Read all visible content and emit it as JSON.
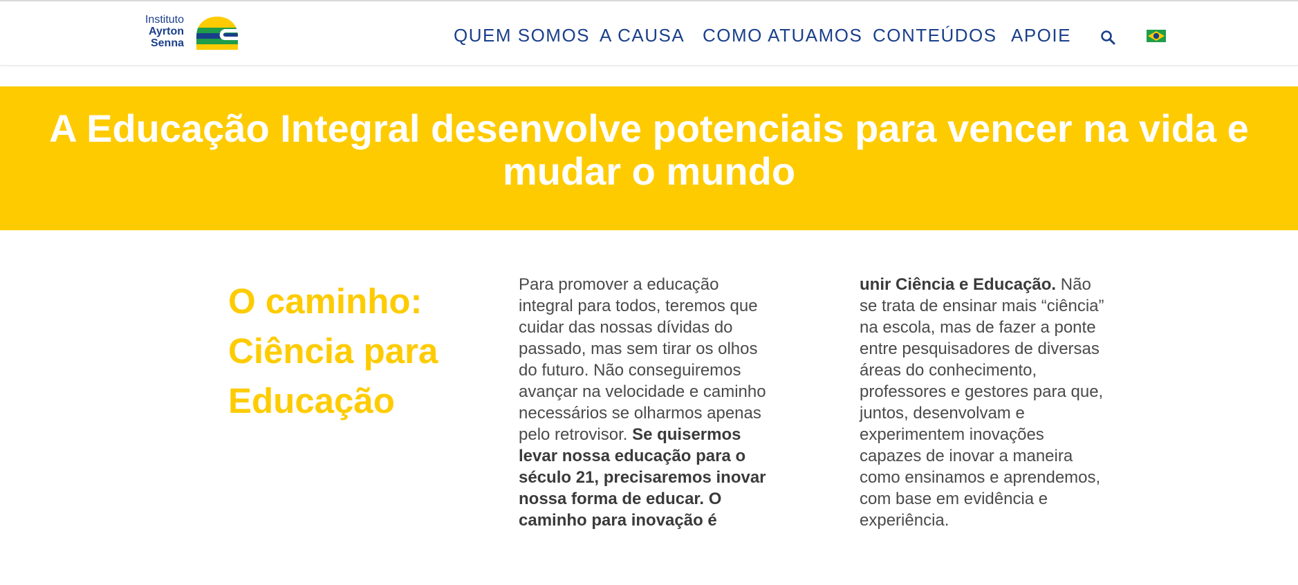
{
  "header": {
    "logo": {
      "line1": "Instituto",
      "line2": "Ayrton",
      "line3": "Senna",
      "icon": "helmet-logo-icon"
    },
    "nav": [
      {
        "label": "QUEM SOMOS"
      },
      {
        "label": "A CAUSA"
      },
      {
        "label": "COMO ATUAMOS"
      },
      {
        "label": "CONTEÚDOS"
      },
      {
        "label": "APOIE"
      }
    ],
    "search_icon": "search-icon",
    "language_flag": "brazil-flag-icon"
  },
  "banner": {
    "title": "A Educação Integral desenvolve potenciais para vencer na vida e mudar o mundo",
    "background": "#fecb00"
  },
  "section": {
    "heading": "O caminho: Ciência para Educação",
    "col1_text": "Para promover a educação integral para todos, teremos que cuidar das nossas dívidas do passado, mas sem tirar os olhos do futuro. Não conseguiremos avançar na velocidade e caminho necessários se olharmos apenas pelo retrovisor. ",
    "col1_bold": "Se quisermos levar nossa educação para o século 21, precisaremos inovar nossa forma de educar. O caminho para inovação é",
    "col2_bold": "unir Ciência e Educação.",
    "col2_text": " Não se trata de ensinar mais “ciência” na escola, mas de fazer a ponte entre pesquisadores de diversas áreas do conhecimento, professores e gestores para que, juntos, desenvolvam e experimentem inovações capazes de inovar a maneira como ensinamos e aprendemos, com base em evidência e experiência."
  },
  "colors": {
    "brand_yellow": "#fecb00",
    "brand_blue": "#1a3f8a"
  }
}
